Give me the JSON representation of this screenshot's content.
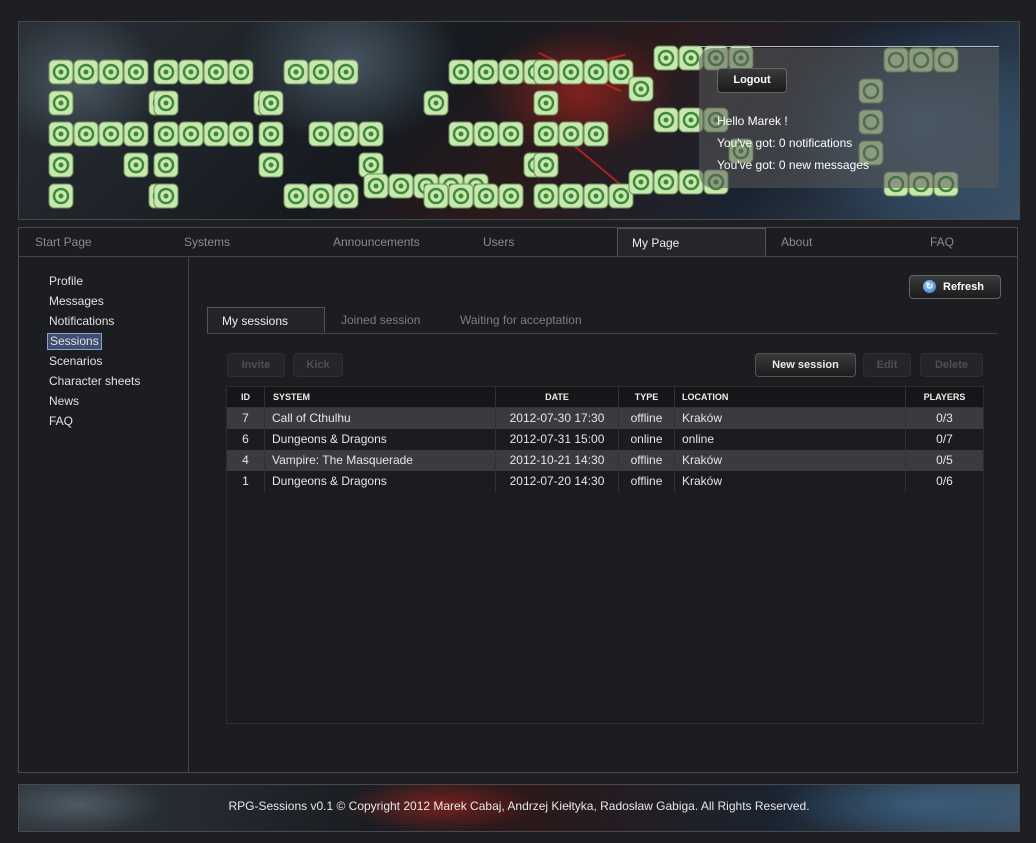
{
  "banner": {
    "logo_text": "RPG-Sessions",
    "logo_letters": [
      "R",
      "P",
      "G",
      "-",
      "S",
      "E",
      "S"
    ],
    "user": {
      "logout_label": "Logout",
      "greeting": "Hello Marek !",
      "notifications": "You've got: 0 notifications",
      "messages": "You've got: 0 new messages"
    }
  },
  "nav": {
    "items": [
      {
        "label": "Start Page"
      },
      {
        "label": "Systems"
      },
      {
        "label": "Announcements"
      },
      {
        "label": "Users"
      },
      {
        "label": "My Page"
      },
      {
        "label": "About"
      },
      {
        "label": "FAQ"
      }
    ],
    "active": "My Page"
  },
  "sidebar": {
    "items": [
      {
        "label": "Profile"
      },
      {
        "label": "Messages"
      },
      {
        "label": "Notifications"
      },
      {
        "label": "Sessions"
      },
      {
        "label": "Scenarios"
      },
      {
        "label": "Character sheets"
      },
      {
        "label": "News"
      },
      {
        "label": "FAQ"
      }
    ],
    "active": "Sessions"
  },
  "content": {
    "refresh_label": "Refresh",
    "refresh_icon": "refresh-icon",
    "tabs": [
      {
        "label": "My sessions"
      },
      {
        "label": "Joined session"
      },
      {
        "label": "Waiting for acceptation"
      }
    ],
    "active_tab": "My sessions",
    "toolbar": {
      "invite_label": "Invite",
      "kick_label": "Kick",
      "new_session_label": "New session",
      "edit_label": "Edit",
      "delete_label": "Delete"
    },
    "table": {
      "columns": [
        "ID",
        "SYSTEM",
        "DATE",
        "TYPE",
        "LOCATION",
        "PLAYERS"
      ],
      "rows": [
        {
          "id": "7",
          "system": "Call of Cthulhu",
          "date": "2012-07-30 17:30",
          "type": "offline",
          "location": "Kraków",
          "players": "0/3"
        },
        {
          "id": "6",
          "system": "Dungeons & Dragons",
          "date": "2012-07-31 15:00",
          "type": "online",
          "location": "online",
          "players": "0/7"
        },
        {
          "id": "4",
          "system": "Vampire: The Masquerade",
          "date": "2012-10-21 14:30",
          "type": "offline",
          "location": "Kraków",
          "players": "0/5"
        },
        {
          "id": "1",
          "system": "Dungeons & Dragons",
          "date": "2012-07-20 14:30",
          "type": "offline",
          "location": "Kraków",
          "players": "0/6"
        }
      ]
    }
  },
  "footer": {
    "text": "RPG-Sessions v0.1 © Copyright 2012  Marek Cabaj, Andrzej Kiełtyka, Radosław Gabiga. All Rights Reserved."
  },
  "colors": {
    "dice_face": "#c9e8b0",
    "dice_pip": "#3f8a3a",
    "selected_sidebar": "#3d4f73"
  }
}
